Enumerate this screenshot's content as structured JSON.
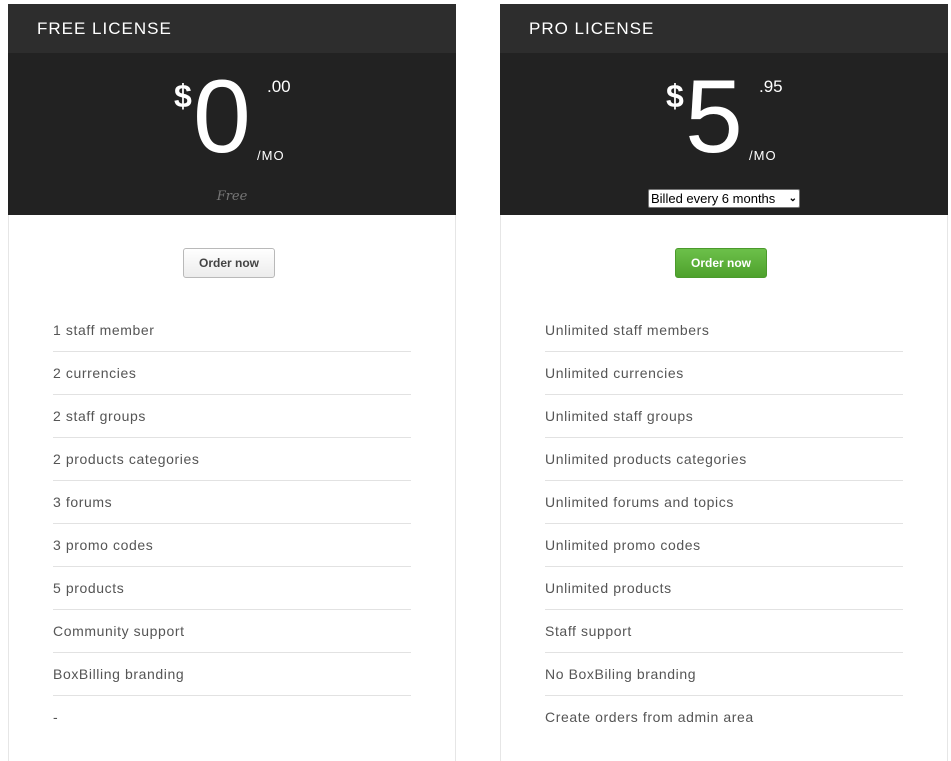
{
  "plans": [
    {
      "title": "FREE LICENSE",
      "currency": "$",
      "amount": "0",
      "cents": ".00",
      "period": "/MO",
      "note": "Free",
      "order_label": "Order now",
      "features": [
        "1 staff member",
        "2 currencies",
        "2 staff groups",
        "2 products categories",
        "3 forums",
        "3 promo codes",
        "5 products",
        "Community support",
        "BoxBilling branding",
        "-"
      ]
    },
    {
      "title": "PRO LICENSE",
      "currency": "$",
      "amount": "5",
      "cents": ".95",
      "period": "/MO",
      "billing_selected": "Billed every 6 months",
      "order_label": "Order now",
      "features": [
        "Unlimited staff members",
        "Unlimited currencies",
        "Unlimited staff groups",
        "Unlimited products categories",
        "Unlimited forums and topics",
        "Unlimited promo codes",
        "Unlimited products",
        "Staff support",
        "No BoxBiling branding",
        "Create orders from admin area"
      ]
    }
  ],
  "colors": {
    "header_bg": "#2d2d2d",
    "price_bg": "#222222",
    "pro_button": "#5aaf36"
  }
}
